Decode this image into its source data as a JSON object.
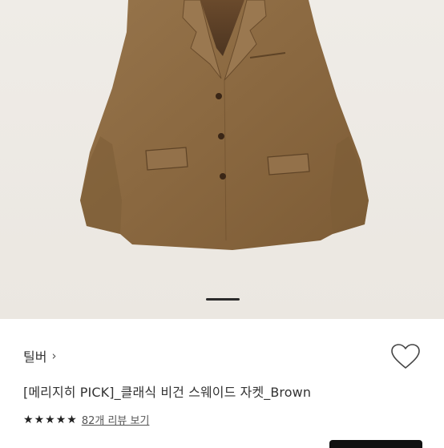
{
  "product": {
    "brand": "틸버",
    "brand_chevron": "›",
    "title": "[메리지히 PICK]_클래식 비건 스웨이드 자켓_Brown",
    "rating_stars": 5,
    "review_link": "82개 리뷰 보기"
  },
  "gallery": {
    "image_subject": "brown suede jacket",
    "current_index": 1
  },
  "colors": {
    "background": "#ffffff",
    "jacket": "#8a6840",
    "photo_background": "#ece8e2"
  },
  "icons": [
    "wishlist-heart-icon",
    "chevron-right-icon",
    "star-icon"
  ]
}
